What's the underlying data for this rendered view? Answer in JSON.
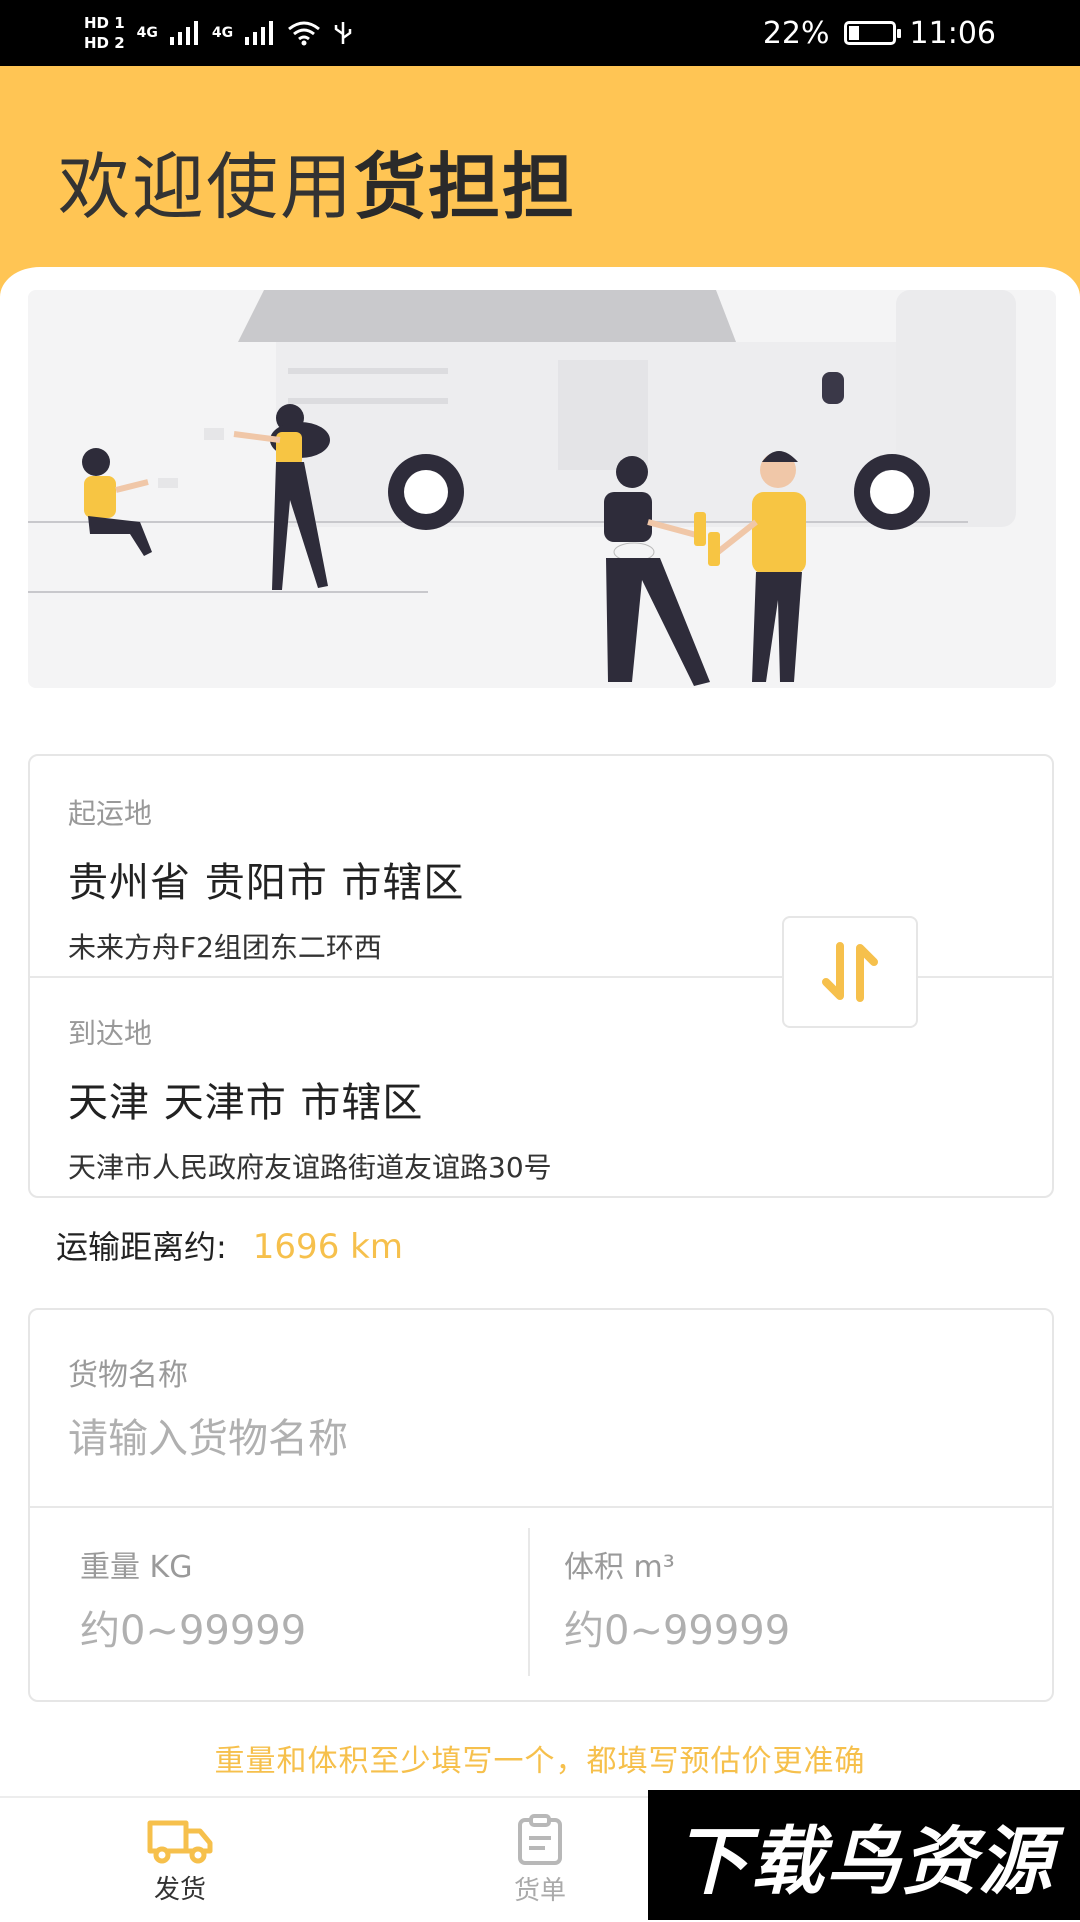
{
  "status_bar": {
    "hd1": "HD 1",
    "hd2": "HD 2",
    "net1": "4G",
    "net2": "4G",
    "battery": "22%",
    "time": "11:06"
  },
  "header": {
    "welcome_prefix": "欢迎使用",
    "brand": "货担担",
    "bg_color": "#ffc554"
  },
  "route": {
    "origin": {
      "label": "起运地",
      "city": "贵州省 贵阳市 市辖区",
      "address": "未来方舟F2组团东二环西"
    },
    "destination": {
      "label": "到达地",
      "city": "天津 天津市 市辖区",
      "address": "天津市人民政府友谊路街道友谊路30号"
    },
    "swap_icon": "swap-vertical-icon"
  },
  "distance": {
    "label": "运输距离约:",
    "value": "1696 km"
  },
  "cargo": {
    "name_label": "货物名称",
    "name_placeholder": "请输入货物名称",
    "weight_label": "重量 KG",
    "weight_placeholder": "约0~99999",
    "volume_label": "体积 m³",
    "volume_placeholder": "约0~99999"
  },
  "hint": "重量和体积至少填写一个，都填写预估价更准确",
  "tabbar": {
    "ship": {
      "label": "发货",
      "icon": "truck-icon"
    },
    "orders": {
      "label": "货单",
      "icon": "clipboard-icon"
    }
  },
  "watermark": "下载鸟资源",
  "colors": {
    "accent": "#f6c04c",
    "figure_dark": "#2e2c3a",
    "figure_yellow": "#f7c543"
  }
}
